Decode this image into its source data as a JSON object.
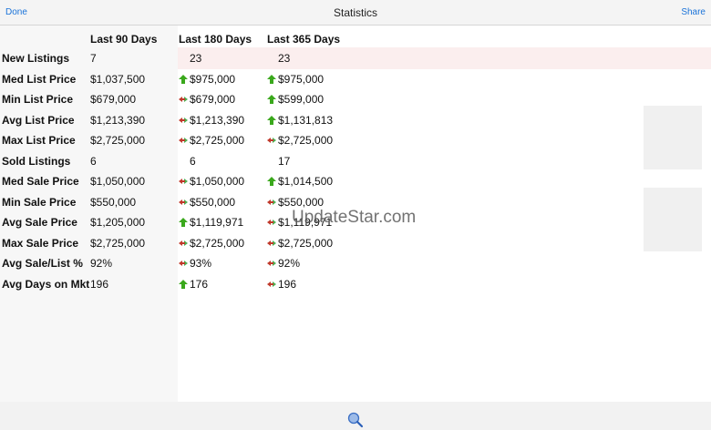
{
  "header": {
    "done": "Done",
    "title": "Statistics",
    "share": "Share"
  },
  "watermark": "UpdateStar.com",
  "columns": [
    "",
    "Last 90 Days",
    "Last 180 Days",
    "Last 365 Days"
  ],
  "colors": {
    "up": "#3aa81c",
    "side_red": "#c0392b",
    "side_green": "#4caf50",
    "link": "#1a73d9"
  },
  "rows": [
    {
      "label": "New Listings",
      "v90": "7",
      "v180": "23",
      "t180": "none",
      "v365": "23",
      "t365": "none"
    },
    {
      "label": "Med List Price",
      "v90": "$1,037,500",
      "v180": "$975,000",
      "t180": "up",
      "v365": "$975,000",
      "t365": "up"
    },
    {
      "label": "Min List Price",
      "v90": "$679,000",
      "v180": "$679,000",
      "t180": "side",
      "v365": "$599,000",
      "t365": "up"
    },
    {
      "label": "Avg List Price",
      "v90": "$1,213,390",
      "v180": "$1,213,390",
      "t180": "side",
      "v365": "$1,131,813",
      "t365": "up"
    },
    {
      "label": "Max List Price",
      "v90": "$2,725,000",
      "v180": "$2,725,000",
      "t180": "side",
      "v365": "$2,725,000",
      "t365": "side"
    },
    {
      "label": "Sold Listings",
      "v90": "6",
      "v180": "6",
      "t180": "none",
      "v365": "17",
      "t365": "none"
    },
    {
      "label": "Med Sale Price",
      "v90": "$1,050,000",
      "v180": "$1,050,000",
      "t180": "side",
      "v365": "$1,014,500",
      "t365": "up"
    },
    {
      "label": "Min Sale Price",
      "v90": "$550,000",
      "v180": "$550,000",
      "t180": "side",
      "v365": "$550,000",
      "t365": "side"
    },
    {
      "label": "Avg Sale Price",
      "v90": "$1,205,000",
      "v180": "$1,119,971",
      "t180": "up",
      "v365": "$1,119,971",
      "t365": "side"
    },
    {
      "label": "Max Sale Price",
      "v90": "$2,725,000",
      "v180": "$2,725,000",
      "t180": "side",
      "v365": "$2,725,000",
      "t365": "side"
    },
    {
      "label": "Avg Sale/List %",
      "v90": "92%",
      "v180": "93%",
      "t180": "side",
      "v365": "92%",
      "t365": "side"
    },
    {
      "label": "Avg Days on Mkt",
      "v90": "196",
      "v180": "176",
      "t180": "up",
      "v365": "196",
      "t365": "side"
    }
  ]
}
